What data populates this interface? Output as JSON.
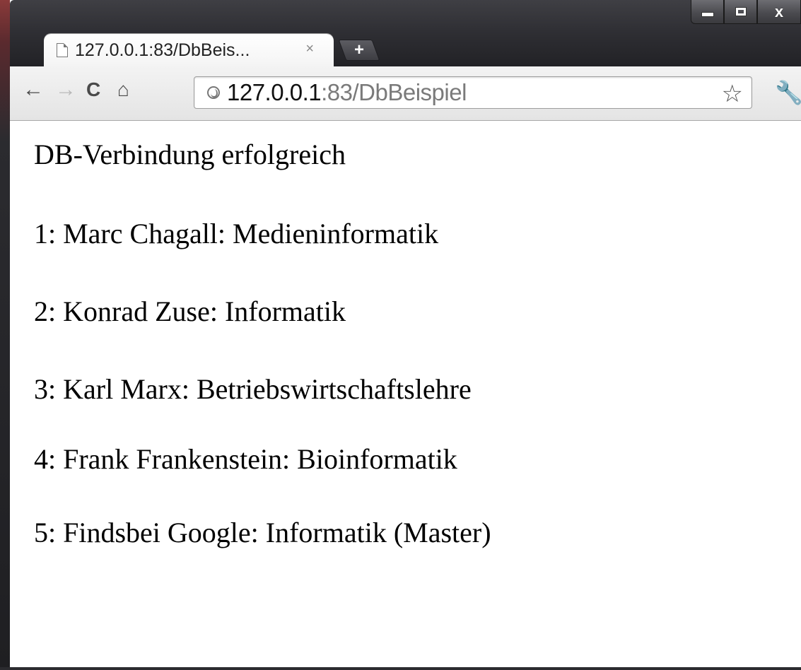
{
  "browser": {
    "tab": {
      "title": "127.0.0.1:83/DbBeis...",
      "close_label": "×"
    },
    "new_tab_label": "+",
    "window_controls": {
      "minimize_icon": "minimize-icon",
      "maximize_icon": "maximize-icon",
      "close_label": "x"
    },
    "toolbar": {
      "back_icon": "←",
      "forward_icon": "→",
      "reload_icon": "C",
      "home_icon": "⌂",
      "star_icon": "☆",
      "wrench_icon": "🔧"
    },
    "address_bar": {
      "host": "127.0.0.1",
      "path": ":83/DbBeispiel"
    }
  },
  "page": {
    "lines": [
      "DB-Verbindung erfolgreich",
      "1: Marc Chagall: Medieninformatik",
      "2: Konrad Zuse: Informatik",
      "3: Karl Marx: Betriebswirtschaftslehre",
      "4: Frank Frankenstein: Bioinformatik",
      "5: Findsbei Google: Informatik (Master)"
    ]
  }
}
